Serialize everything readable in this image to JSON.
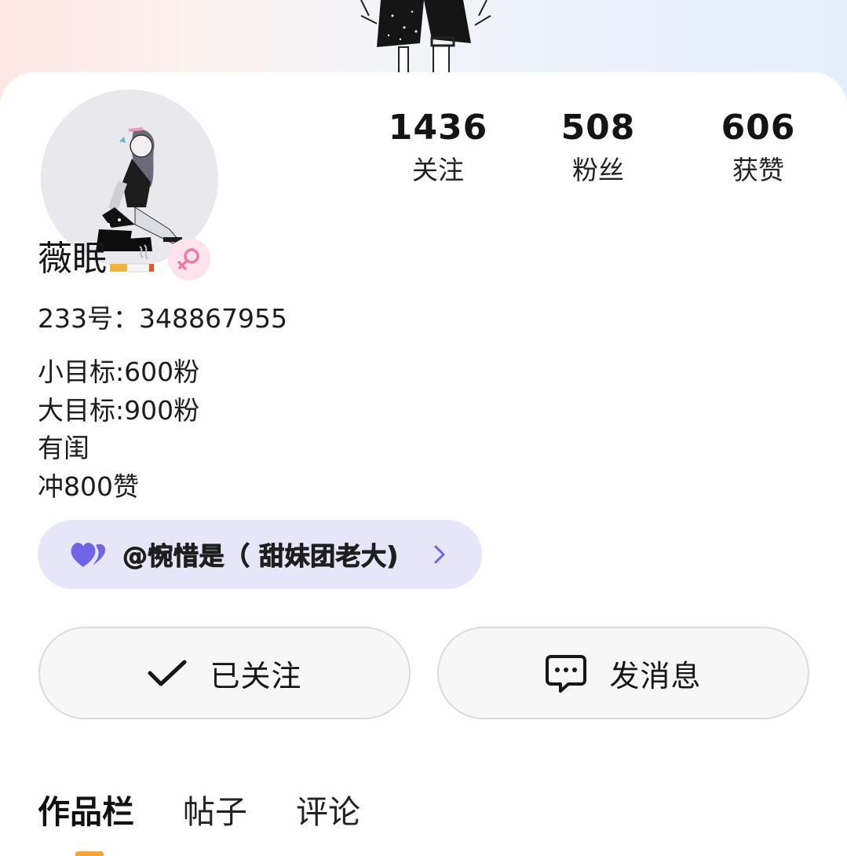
{
  "banner": {
    "gradient_left": "#fde7e4",
    "gradient_right": "#e4eefb"
  },
  "profile": {
    "avatar_icon": "avatar-illustration",
    "name": "薇眠",
    "name_emoji": "cigarette-icon",
    "gender_icon": "female-symbol-icon",
    "gender_color": "#f07aa0",
    "uid_label": "233号：348867955"
  },
  "stats": [
    {
      "value": "1436",
      "label": "关注"
    },
    {
      "value": "508",
      "label": "粉丝"
    },
    {
      "value": "606",
      "label": "获赞"
    }
  ],
  "bio": [
    "小目标:600粉",
    "大目标:900粉",
    "有闺",
    "冲800赞"
  ],
  "relation": {
    "icon": "hearts-icon",
    "text": "@惋惜是（ 甜妹团老大)",
    "accent": "#6f63e6",
    "chevron_icon": "chevron-right-icon"
  },
  "actions": {
    "follow": {
      "icon": "check-icon",
      "label": "已关注"
    },
    "message": {
      "icon": "chat-bubble-icon",
      "label": "发消息"
    }
  },
  "tabs": [
    {
      "label": "作品栏",
      "active": true
    },
    {
      "label": "帖子",
      "active": false
    },
    {
      "label": "评论",
      "active": false
    }
  ]
}
